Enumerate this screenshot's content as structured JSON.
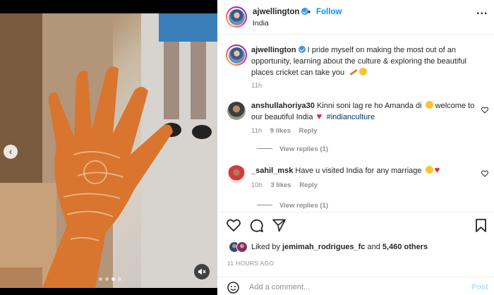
{
  "post": {
    "username": "ajwellington",
    "follow_label": "Follow",
    "separator": "•",
    "location": "India",
    "more_label": "..."
  },
  "media": {
    "prev_label": "‹",
    "slide_count": 4,
    "active_slide": 3
  },
  "caption": {
    "username": "ajwellington",
    "text": "I pride myself on making the most out of an opportunity, learning about the culture & exploring the beautiful places cricket can take you",
    "time": "11h",
    "emoji_icons": [
      "cricket-bat-icon",
      "smiling-face-icon"
    ]
  },
  "comments": [
    {
      "username": "anshullahoriya30",
      "text": "Kinni soni lag re ho Amanda di",
      "text_after": "welcome to our beautiful India",
      "hashtag": "#indianculture",
      "time": "11h",
      "likes": "9 likes",
      "reply_label": "Reply",
      "view_replies": "View replies (1)"
    },
    {
      "username": "_sahil_msk",
      "text": "Have u visited India for any marriage",
      "time": "10h",
      "likes": "3 likes",
      "reply_label": "Reply",
      "view_replies": "View replies (1)"
    }
  ],
  "likes": {
    "prefix": "Liked by",
    "user": "jemimah_rodrigues_fc",
    "middle": "and",
    "count": "5,460 others"
  },
  "timestamp": "11 HOURS AGO",
  "add_comment": {
    "placeholder": "Add a comment...",
    "post_label": "Post"
  },
  "colors": {
    "link": "#0095f6",
    "verified": "#3897f0",
    "heart": "#e0245e",
    "muted_text": "#8e8e8e"
  }
}
